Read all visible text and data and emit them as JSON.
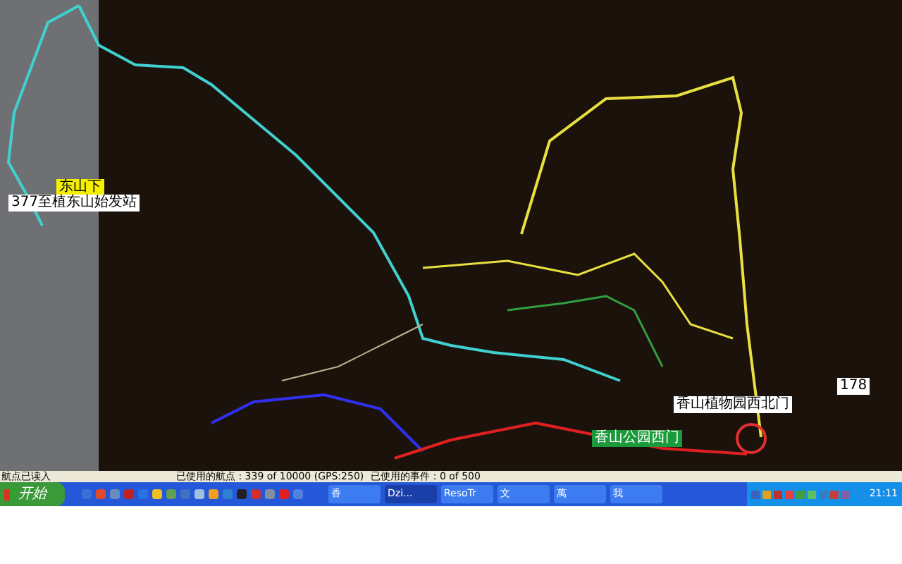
{
  "map": {
    "labels": [
      {
        "text": "东山下",
        "kind": "yellow"
      },
      {
        "text": "377至植东山始发站",
        "kind": "white"
      },
      {
        "text": "香山植物园西北门",
        "kind": "white"
      },
      {
        "text": "178",
        "kind": "white"
      },
      {
        "text": "香山公园西门",
        "kind": "green"
      }
    ]
  },
  "status_bar": {
    "message": "航点已读入",
    "waypoints": "已使用的航点 : 339 of 10000 (GPS:250)",
    "events": "已使用的事件 : 0 of 500"
  },
  "taskbar": {
    "start": "开始",
    "tasks": [
      {
        "label": "香",
        "selected": false
      },
      {
        "label": "Dzi...",
        "selected": true
      },
      {
        "label": "ResoTr",
        "selected": false
      },
      {
        "label": "文",
        "selected": false
      },
      {
        "label": "萬",
        "selected": false
      },
      {
        "label": "我",
        "selected": false
      }
    ],
    "clock": "21:11"
  }
}
